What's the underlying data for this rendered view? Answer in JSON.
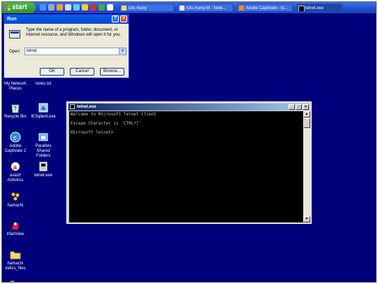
{
  "taskbar": {
    "start_label": "start",
    "tasks": [
      {
        "label": "tuts many",
        "icon": "folder-icon"
      },
      {
        "label": "tuts many.txt - Note...",
        "icon": "notepad-icon"
      },
      {
        "label": "Adobe Captivate - tu...",
        "icon": "captivate-icon"
      },
      {
        "label": "telnet.exe",
        "icon": "console-icon"
      }
    ]
  },
  "desktop": {
    "icons": [
      {
        "label": "My Network Places",
        "icon": "network-places-icon"
      },
      {
        "label": "notes.txt",
        "icon": "text-file-icon"
      },
      {
        "label": "Recycle Bin",
        "icon": "recycle-bin-icon"
      },
      {
        "label": "IESqlient.exe",
        "icon": "exe-icon"
      },
      {
        "label": "Adobe Captivate 2",
        "icon": "captivate-icon"
      },
      {
        "label": "Parallels Shared Folders",
        "icon": "shared-folders-icon"
      },
      {
        "label": "avast! Antivirus",
        "icon": "antivirus-icon"
      },
      {
        "label": "telnet.exe",
        "icon": "console-icon"
      },
      {
        "label": "hamachi",
        "icon": "hamachi-icon"
      },
      {
        "label": "IrfanView",
        "icon": "irfanview-icon"
      },
      {
        "label": "hamachi indics_files",
        "icon": "folder-icon"
      }
    ]
  },
  "run_dialog": {
    "title": "Run",
    "description": "Type the name of a program, folder, document, or Internet resource, and Windows will open it for you.",
    "open_label": "Open:",
    "input_value": "telnet",
    "ok_label": "OK",
    "cancel_label": "Cancel",
    "browse_label": "Browse..."
  },
  "telnet_window": {
    "title": "telnet.exe",
    "lines": [
      "Welcome to Microsoft Telnet Client",
      "Escape Character is 'CTRL+]'",
      "Microsoft Telnet>"
    ]
  },
  "colors": {
    "desktop_bg": "#00007b",
    "taskbar": "#1f4fc9",
    "start_green": "#2f8f2f",
    "console_bg": "#000000"
  }
}
